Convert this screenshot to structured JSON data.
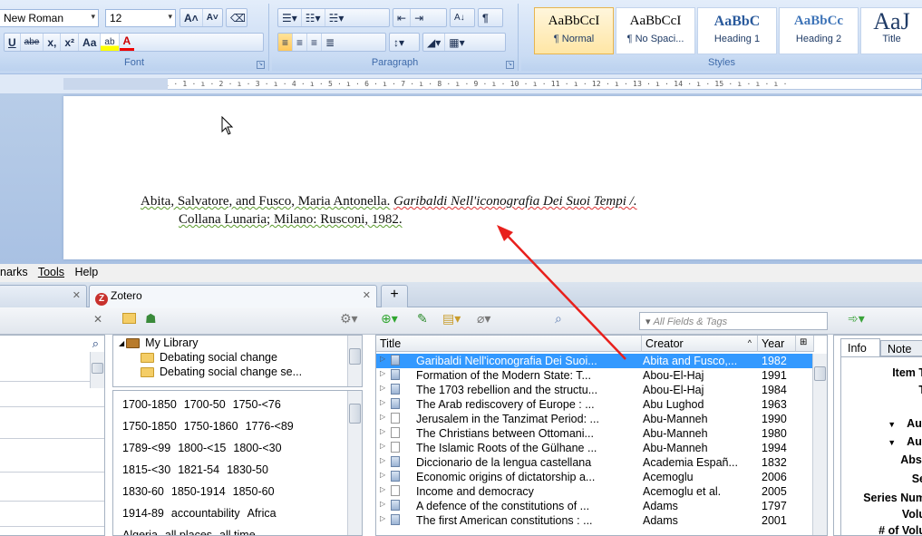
{
  "ribbon": {
    "font_name": "New Roman",
    "font_size": "12",
    "font_group_label": "Font",
    "paragraph_group_label": "Paragraph",
    "styles_group_label": "Styles",
    "font_buttons": [
      "U",
      "abe",
      "x,",
      "x²",
      "Aa",
      "ab",
      "A"
    ],
    "grow_font": "A",
    "shrink_font": "A",
    "styles": [
      {
        "preview": "AaBbCcI",
        "name": "¶ Normal"
      },
      {
        "preview": "AaBbCcI",
        "name": "¶ No Spaci..."
      },
      {
        "preview": "AaBbC",
        "name": "Heading 1"
      },
      {
        "preview": "AaBbCc",
        "name": "Heading 2"
      },
      {
        "preview": "AaJ",
        "name": "Title"
      }
    ]
  },
  "ruler": {
    "ticks": "· 2 · ı · 1 · ı · ı · ı · 1 · ı · 2 · ı · 3 · ı · 4 · ı · 5 · ı · 6 · ı · 7 · ı · 8 · ı · 9 · ı · 10 · ı · 11 · ı · 12 · ı · 13 · ı · 14 · ı · 15 · ı · ı · ı ·"
  },
  "document": {
    "citation_author": "Abita, Salvatore, and Fusco, Maria  Antonella.",
    "citation_title": "Garibaldi Nell'iconografia  Dei Suoi Tempi /.",
    "citation_line2": "Collana Lunaria; Milano: Rusconi, 1982."
  },
  "menubar": {
    "items": [
      "narks",
      "Tools",
      "Help"
    ]
  },
  "tabs": {
    "zotero_label": "Zotero",
    "new_tab": "+"
  },
  "zotero": {
    "search_placeholder": "All Fields & Tags",
    "collections": [
      {
        "label": "My Library",
        "type": "library"
      },
      {
        "label": "Debating social change",
        "type": "folder"
      },
      {
        "label": "Debating social change se...",
        "type": "folder"
      }
    ],
    "tags": [
      [
        "1700-1850",
        "1700-50",
        "1750-<76"
      ],
      [
        "1750-1850",
        "1750-1860",
        "1776-<89"
      ],
      [
        "1789-<99",
        "1800-<15",
        "1800-<30"
      ],
      [
        "1815-<30",
        "1821-54",
        "1830-50"
      ],
      [
        "1830-60",
        "1850-1914",
        "1850-60"
      ],
      [
        "1914-89",
        "accountability",
        "Africa"
      ],
      [
        "Algeria",
        "all places",
        "all time"
      ]
    ],
    "columns": {
      "title": "Title",
      "creator": "Creator",
      "year": "Year"
    },
    "items": [
      {
        "title": "Garibaldi Nell'iconografia Dei Suoi...",
        "creator": "Abita and Fusco,...",
        "year": "1982",
        "selected": true
      },
      {
        "title": "Formation of the Modern State: T...",
        "creator": "Abou-El-Haj",
        "year": "1991"
      },
      {
        "title": "The 1703 rebellion and the structu...",
        "creator": "Abou-El-Haj",
        "year": "1984"
      },
      {
        "title": "The Arab rediscovery of Europe : ...",
        "creator": "Abu Lughod",
        "year": "1963"
      },
      {
        "title": "Jerusalem in the Tanzimat Period: ...",
        "creator": "Abu-Manneh",
        "year": "1990"
      },
      {
        "title": "The Christians between Ottomani...",
        "creator": "Abu-Manneh",
        "year": "1980"
      },
      {
        "title": "The Islamic Roots of the Gülhane ...",
        "creator": "Abu-Manneh",
        "year": "1994"
      },
      {
        "title": "Diccionario de la lengua castellana",
        "creator": "Academia Españ...",
        "year": "1832"
      },
      {
        "title": "Economic origins of dictatorship a...",
        "creator": "Acemoglu",
        "year": "2006"
      },
      {
        "title": "Income and democracy",
        "creator": "Acemoglu et al.",
        "year": "2005"
      },
      {
        "title": "A defence of the constitutions of ...",
        "creator": "Adams",
        "year": "1797"
      },
      {
        "title": "The first American constitutions : ...",
        "creator": "Adams",
        "year": "2001"
      }
    ],
    "info_tabs": [
      "Info",
      "Note"
    ],
    "info_labels": [
      "Item T",
      "T",
      "Aut",
      "Aut",
      "Abst",
      "Se",
      "Series Num",
      "Volu",
      "# of Volu"
    ]
  },
  "colors": {
    "selection": "#3399ff",
    "arrow": "#e8201c",
    "ribbon": "#cfdff5"
  }
}
